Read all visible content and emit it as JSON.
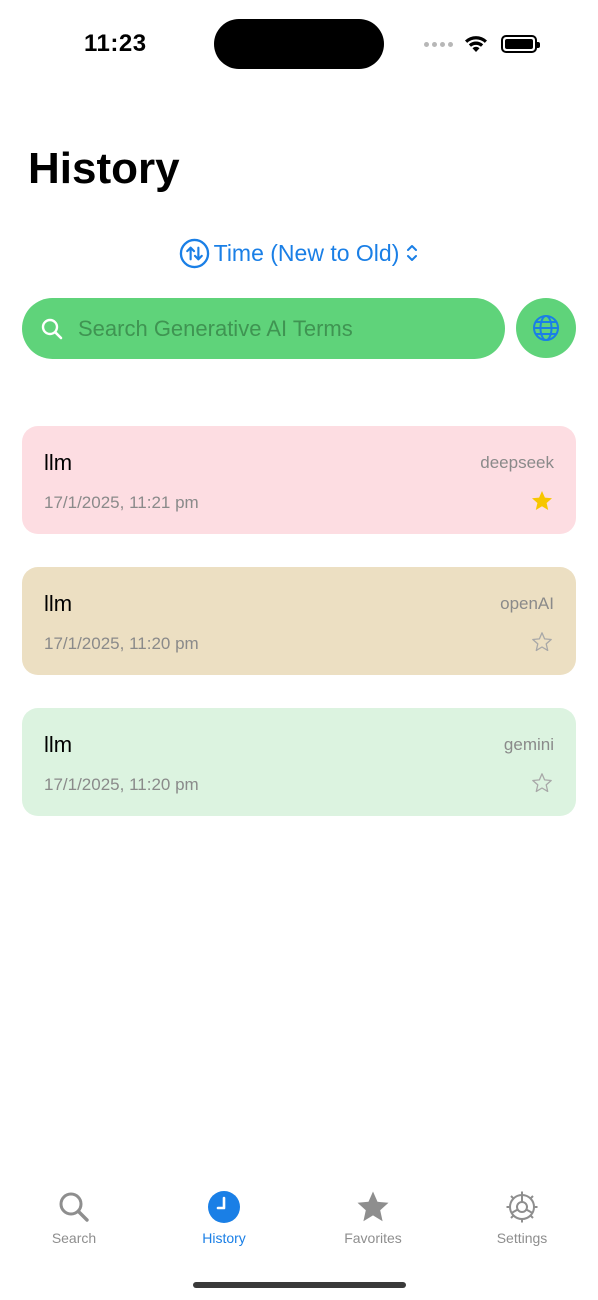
{
  "status": {
    "time": "11:23"
  },
  "page": {
    "title": "History"
  },
  "sort": {
    "label": "Time (New to Old)"
  },
  "search": {
    "placeholder": "Search Generative AI Terms"
  },
  "colors": {
    "accent": "#1a7fe6",
    "search_bg": "#5fd37a",
    "card_pink": "#fddde2",
    "card_tan": "#ecdfc2",
    "card_green": "#dcf3e0",
    "star_yellow": "#f7c600"
  },
  "history": [
    {
      "term": "llm",
      "source": "deepseek",
      "time": "17/1/2025, 11:21 pm",
      "favorite": true
    },
    {
      "term": "llm",
      "source": "openAI",
      "time": "17/1/2025, 11:20 pm",
      "favorite": false
    },
    {
      "term": "llm",
      "source": "gemini",
      "time": "17/1/2025, 11:20 pm",
      "favorite": false
    }
  ],
  "tabs": [
    {
      "label": "Search",
      "icon": "magnifier-icon",
      "active": false
    },
    {
      "label": "History",
      "icon": "clock-icon",
      "active": true
    },
    {
      "label": "Favorites",
      "icon": "star-icon",
      "active": false
    },
    {
      "label": "Settings",
      "icon": "gear-icon",
      "active": false
    }
  ]
}
